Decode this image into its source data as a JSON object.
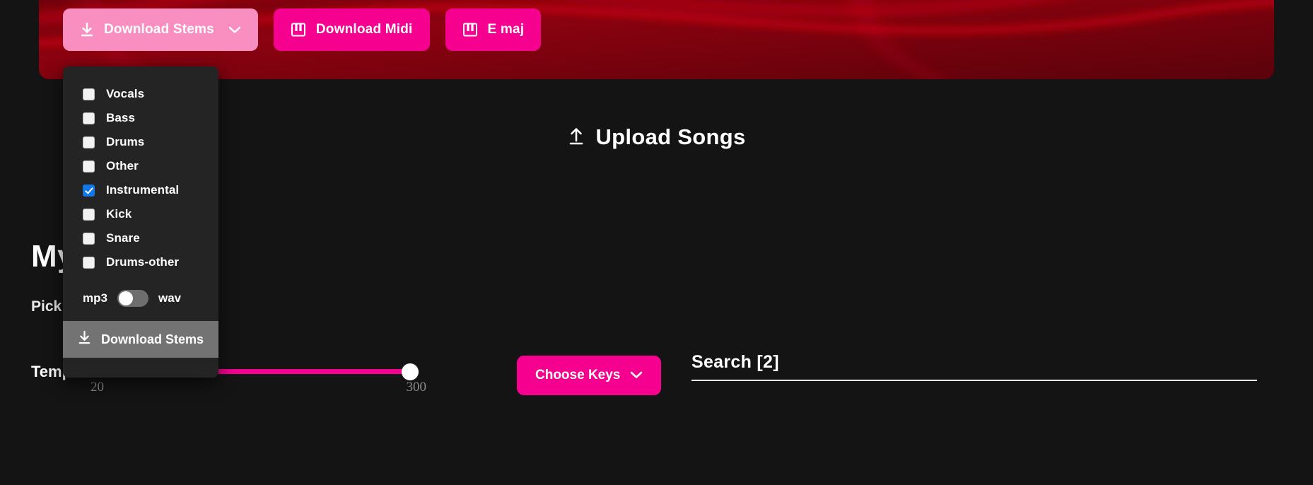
{
  "banner": {
    "accent_color": "#f5008f",
    "texture": "red-marble-swirl"
  },
  "toolbar": {
    "download_stems": {
      "label": "Download Stems",
      "icon": "download-icon",
      "chevron": "chevron-down-icon"
    },
    "download_midi": {
      "label": "Download Midi",
      "icon": "piano-icon"
    },
    "key_badge": {
      "label": "E maj",
      "icon": "piano-icon"
    }
  },
  "stems_dropdown": {
    "options": [
      {
        "label": "Vocals",
        "checked": false
      },
      {
        "label": "Bass",
        "checked": false
      },
      {
        "label": "Drums",
        "checked": false
      },
      {
        "label": "Other",
        "checked": false
      },
      {
        "label": "Instrumental",
        "checked": true
      },
      {
        "label": "Kick",
        "checked": false
      },
      {
        "label": "Snare",
        "checked": false
      },
      {
        "label": "Drums-other",
        "checked": false
      }
    ],
    "format_toggle": {
      "left_label": "mp3",
      "right_label": "wav",
      "selected": "mp3"
    },
    "download_button": {
      "label": "Download Stems",
      "icon": "download-icon"
    }
  },
  "upload": {
    "label": "Upload Songs",
    "icon": "upload-icon"
  },
  "library": {
    "title": "My Songs",
    "subtitle": "Pick a song to preview it."
  },
  "filters": {
    "tempo_label": "Tempo",
    "tempo_min": "20",
    "tempo_max": "300",
    "tempo_value": 300,
    "choose_keys": {
      "label": "Choose Keys",
      "chevron": "chevron-down-icon"
    },
    "search": {
      "value": "Search [2]",
      "placeholder": "Search"
    }
  }
}
